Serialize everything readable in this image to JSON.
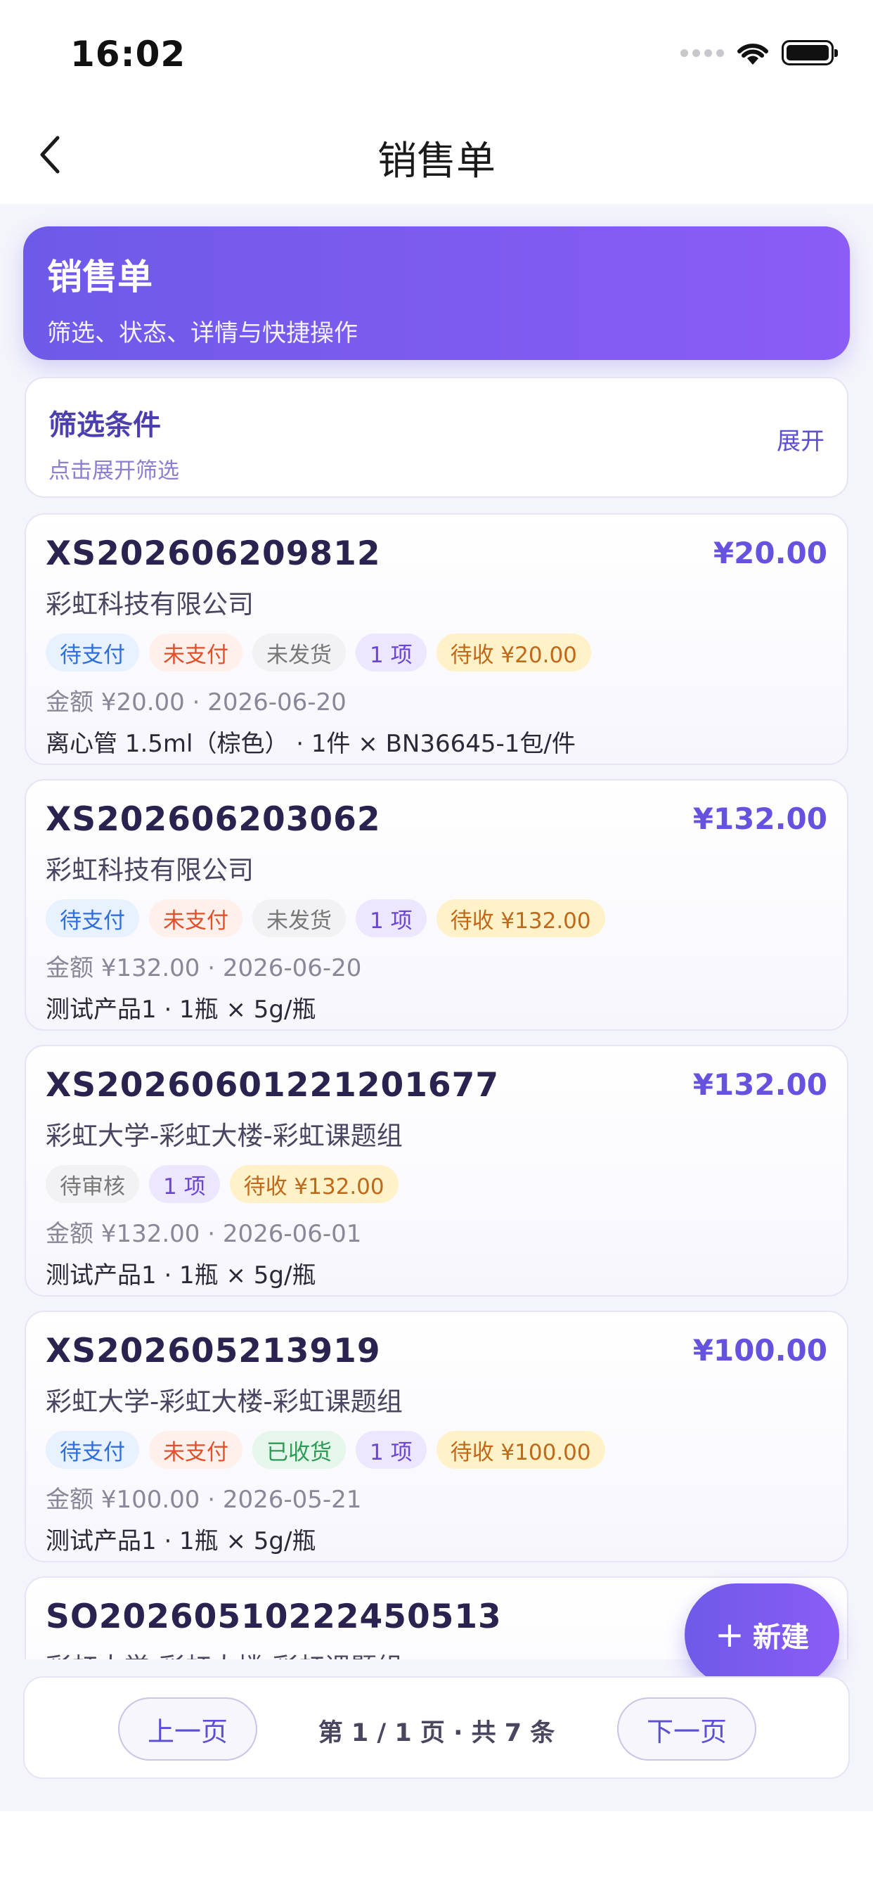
{
  "status": {
    "time": "16:02"
  },
  "nav": {
    "title": "销售单"
  },
  "hero": {
    "title": "销售单",
    "subtitle": "筛选、状态、详情与快捷操作"
  },
  "filter": {
    "title": "筛选条件",
    "hint": "点击展开筛选",
    "expand_label": "展开"
  },
  "orders": [
    {
      "order_no": "XS202606209812",
      "amount": "¥20.00",
      "customer": "彩虹科技有限公司",
      "tags": [
        {
          "label": "待支付",
          "color": "blue"
        },
        {
          "label": "未支付",
          "color": "red"
        },
        {
          "label": "未发货",
          "color": "gray"
        },
        {
          "label": "1 项",
          "color": "purple"
        },
        {
          "label": "待收 ¥20.00",
          "color": "yellow"
        }
      ],
      "meta": "金额 ¥20.00 · 2026-06-20",
      "items": "离心管 1.5ml（棕色） · 1件 × BN36645-1包/件"
    },
    {
      "order_no": "XS202606203062",
      "amount": "¥132.00",
      "customer": "彩虹科技有限公司",
      "tags": [
        {
          "label": "待支付",
          "color": "blue"
        },
        {
          "label": "未支付",
          "color": "red"
        },
        {
          "label": "未发货",
          "color": "gray"
        },
        {
          "label": "1 项",
          "color": "purple"
        },
        {
          "label": "待收 ¥132.00",
          "color": "yellow"
        }
      ],
      "meta": "金额 ¥132.00 · 2026-06-20",
      "items": "测试产品1 · 1瓶 × 5g/瓶"
    },
    {
      "order_no": "XS20260601221201677",
      "amount": "¥132.00",
      "customer": "彩虹大学-彩虹大楼-彩虹课题组",
      "tags": [
        {
          "label": "待审核",
          "color": "gray"
        },
        {
          "label": "1 项",
          "color": "purple"
        },
        {
          "label": "待收 ¥132.00",
          "color": "yellow"
        }
      ],
      "meta": "金额 ¥132.00 · 2026-06-01",
      "items": "测试产品1 · 1瓶 × 5g/瓶"
    },
    {
      "order_no": "XS202605213919",
      "amount": "¥100.00",
      "customer": "彩虹大学-彩虹大楼-彩虹课题组",
      "tags": [
        {
          "label": "待支付",
          "color": "blue"
        },
        {
          "label": "未支付",
          "color": "red"
        },
        {
          "label": "已收货",
          "color": "green"
        },
        {
          "label": "1 项",
          "color": "purple"
        },
        {
          "label": "待收 ¥100.00",
          "color": "yellow"
        }
      ],
      "meta": "金额 ¥100.00 · 2026-05-21",
      "items": "测试产品1 · 1瓶 × 5g/瓶"
    },
    {
      "order_no": "SO20260510222450513",
      "amount": "",
      "customer": "彩虹大学-彩虹大楼-彩虹课题组",
      "tags": [],
      "meta": "",
      "items": ""
    }
  ],
  "fab": {
    "label": "新建"
  },
  "pagination": {
    "prev_label": "上一页",
    "next_label": "下一页",
    "info": "第 1 / 1 页 · 共 7 条"
  }
}
